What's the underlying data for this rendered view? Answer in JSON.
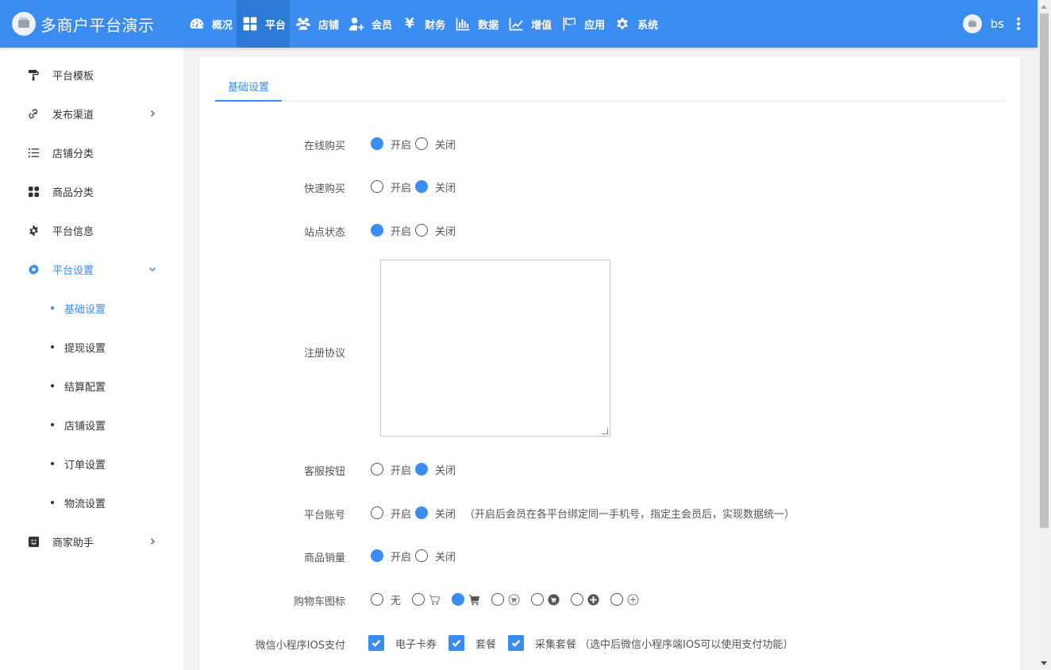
{
  "header": {
    "title": "多商户平台演示",
    "user_name": "bs",
    "nav": [
      {
        "label": "概况",
        "icon": "dashboard-icon"
      },
      {
        "label": "平台",
        "icon": "grid-icon",
        "active": true
      },
      {
        "label": "店铺",
        "icon": "users-icon"
      },
      {
        "label": "会员",
        "icon": "user-plus-icon"
      },
      {
        "label": "财务",
        "icon": "yen-icon"
      },
      {
        "label": "数据",
        "icon": "bar-chart-icon"
      },
      {
        "label": "增值",
        "icon": "line-chart-icon"
      },
      {
        "label": "应用",
        "icon": "flag-icon"
      },
      {
        "label": "系统",
        "icon": "gear-icon"
      }
    ]
  },
  "sidebar": {
    "items": [
      {
        "label": "平台模板",
        "icon": "paint-roller-icon"
      },
      {
        "label": "发布渠道",
        "icon": "link-icon",
        "has_children": true
      },
      {
        "label": "店铺分类",
        "icon": "list-icon"
      },
      {
        "label": "商品分类",
        "icon": "tiles-icon"
      },
      {
        "label": "平台信息",
        "icon": "gear-icon"
      },
      {
        "label": "平台设置",
        "icon": "settings-icon",
        "active": true,
        "expanded": true
      },
      {
        "label": "商家助手",
        "icon": "smile-icon",
        "has_children": true
      }
    ],
    "sub_items": [
      {
        "label": "基础设置",
        "active": true
      },
      {
        "label": "提现设置"
      },
      {
        "label": "结算配置"
      },
      {
        "label": "店铺设置"
      },
      {
        "label": "订单设置"
      },
      {
        "label": "物流设置"
      }
    ]
  },
  "main": {
    "tab": "基础设置",
    "on_label": "开启",
    "off_label": "关闭",
    "none_label": "无",
    "rows": {
      "online_buy": {
        "label": "在线购买",
        "value": "on"
      },
      "quick_buy": {
        "label": "快速购买",
        "value": "off"
      },
      "site_status": {
        "label": "站点状态",
        "value": "on"
      },
      "agreement": {
        "label": "注册协议",
        "value": ""
      },
      "service_button": {
        "label": "客服按钮",
        "value": "off"
      },
      "platform_account": {
        "label": "平台账号",
        "value": "off",
        "note": "（开启后会员在各平台绑定同一手机号，指定主会员后，实现数据统一）"
      },
      "sales_count": {
        "label": "商品销量",
        "value": "on"
      },
      "cart_icon": {
        "label": "购物车图标",
        "selected_index": 2,
        "options": [
          "none",
          "cart-outline-icon",
          "cart-solid-icon",
          "cart-circle-outline-icon",
          "cart-circle-solid-icon",
          "plus-circle-solid-icon",
          "plus-circle-outline-icon"
        ]
      },
      "ios_pay": {
        "label": "微信小程序IOS支付",
        "options": [
          {
            "label": "电子卡券",
            "checked": true
          },
          {
            "label": "套餐",
            "checked": true
          },
          {
            "label": "采集套餐",
            "checked": true
          }
        ],
        "note": "（选中后微信小程序端IOS可以使用支付功能）"
      }
    }
  },
  "colors": {
    "primary": "#3b8cf0",
    "header_bg": "#3b8cf0",
    "active_nav_bg": "#2d7ad6"
  }
}
